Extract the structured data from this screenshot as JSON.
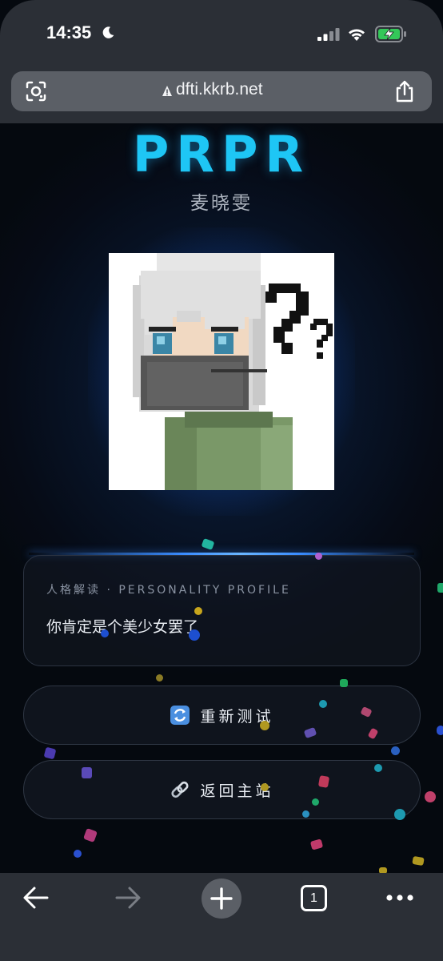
{
  "status_bar": {
    "time": "14:35",
    "icons": [
      "moon-icon",
      "signal-icon",
      "wifi-icon",
      "battery-charging-icon"
    ]
  },
  "browser": {
    "url": "dfti.kkrb.net",
    "icons": [
      "lens-icon",
      "warning-lock-icon",
      "share-icon"
    ]
  },
  "header": {
    "title": "PRPR",
    "subtitle": "麦晓雯"
  },
  "profile_card": {
    "label": "人格解读 · PERSONALITY PROFILE",
    "text": "你肯定是个美少女罢了"
  },
  "buttons": {
    "retry": {
      "icon": "refresh-icon",
      "label": "重新测试"
    },
    "home": {
      "icon": "link-icon",
      "label": "返回主站"
    }
  },
  "toolbar": {
    "tab_count": "1",
    "icons": [
      "back-arrow-icon",
      "forward-arrow-icon",
      "plus-icon",
      "tabs-icon",
      "more-icon"
    ]
  },
  "colors": {
    "accent": "#1ec6f5",
    "background": "#05090f",
    "chrome": "#2b2f36",
    "url_bar": "#5b5f66"
  }
}
